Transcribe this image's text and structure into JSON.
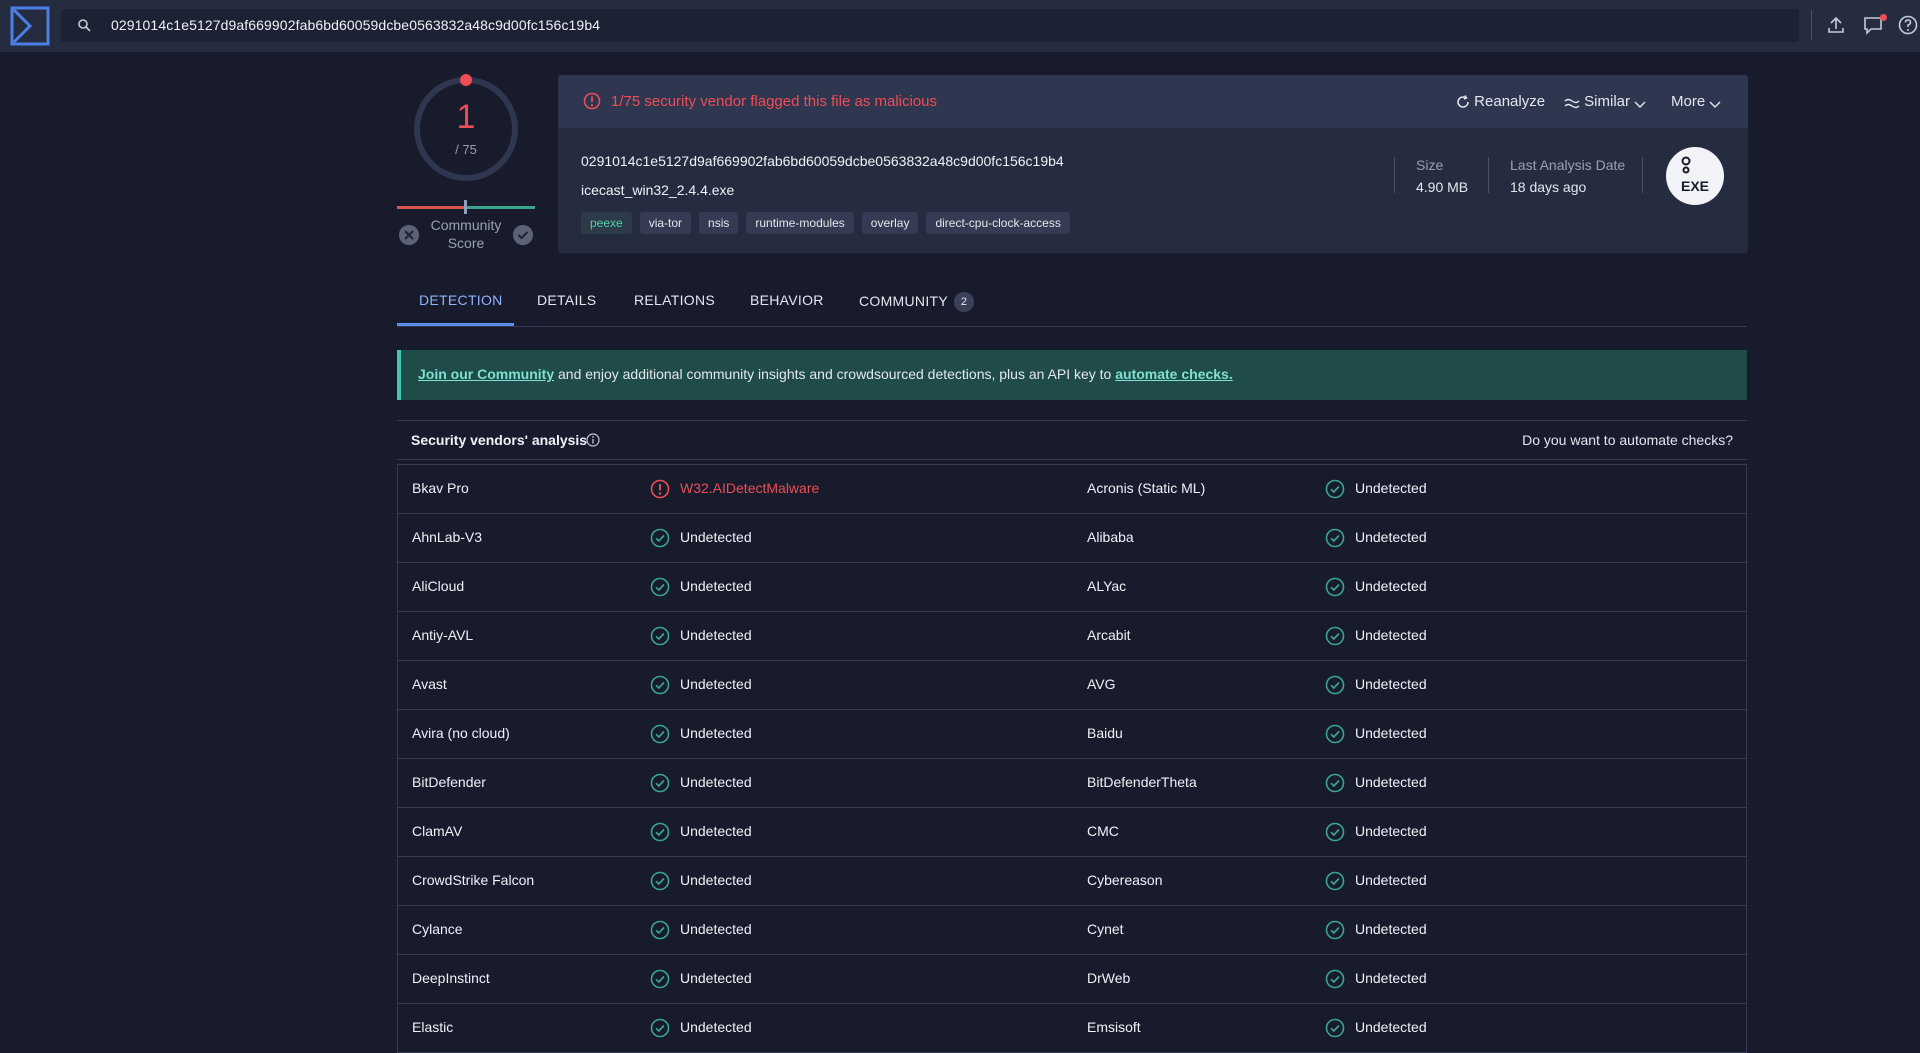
{
  "search": {
    "value": "0291014c1e5127d9af669902fab6bd60059dcbe0563832a48c9d00fc156c19b4"
  },
  "score": {
    "detections": "1",
    "total": "/ 75",
    "community_label_1": "Community",
    "community_label_2": "Score"
  },
  "alert": {
    "text": "1/75 security vendor flagged this file as malicious"
  },
  "actions": {
    "reanalyze": "Reanalyze",
    "similar": "Similar",
    "more": "More"
  },
  "file": {
    "hash": "0291014c1e5127d9af669902fab6bd60059dcbe0563832a48c9d00fc156c19b4",
    "name": "icecast_win32_2.4.4.exe",
    "tags": [
      "peexe",
      "via-tor",
      "nsis",
      "runtime-modules",
      "overlay",
      "direct-cpu-clock-access"
    ],
    "size_label": "Size",
    "size_value": "4.90 MB",
    "date_label": "Last Analysis Date",
    "date_value": "18 days ago",
    "type_badge": "EXE"
  },
  "tabs": [
    {
      "label": "DETECTION"
    },
    {
      "label": "DETAILS"
    },
    {
      "label": "RELATIONS"
    },
    {
      "label": "BEHAVIOR"
    },
    {
      "label": "COMMUNITY",
      "count": "2"
    }
  ],
  "banner": {
    "link1": "Join our Community",
    "middle": " and enjoy additional community insights and crowdsourced detections, plus an API key to ",
    "link2": "automate checks."
  },
  "vendors_section": {
    "title": "Security vendors' analysis",
    "automate": "Do you want to automate checks?"
  },
  "vendors": [
    {
      "left": "Bkav Pro",
      "left_result": "W32.AIDetectMalware",
      "left_malicious": true,
      "right": "Acronis (Static ML)",
      "right_result": "Undetected"
    },
    {
      "left": "AhnLab-V3",
      "left_result": "Undetected",
      "right": "Alibaba",
      "right_result": "Undetected"
    },
    {
      "left": "AliCloud",
      "left_result": "Undetected",
      "right": "ALYac",
      "right_result": "Undetected"
    },
    {
      "left": "Antiy-AVL",
      "left_result": "Undetected",
      "right": "Arcabit",
      "right_result": "Undetected"
    },
    {
      "left": "Avast",
      "left_result": "Undetected",
      "right": "AVG",
      "right_result": "Undetected"
    },
    {
      "left": "Avira (no cloud)",
      "left_result": "Undetected",
      "right": "Baidu",
      "right_result": "Undetected"
    },
    {
      "left": "BitDefender",
      "left_result": "Undetected",
      "right": "BitDefenderTheta",
      "right_result": "Undetected"
    },
    {
      "left": "ClamAV",
      "left_result": "Undetected",
      "right": "CMC",
      "right_result": "Undetected"
    },
    {
      "left": "CrowdStrike Falcon",
      "left_result": "Undetected",
      "right": "Cybereason",
      "right_result": "Undetected"
    },
    {
      "left": "Cylance",
      "left_result": "Undetected",
      "right": "Cynet",
      "right_result": "Undetected"
    },
    {
      "left": "DeepInstinct",
      "left_result": "Undetected",
      "right": "DrWeb",
      "right_result": "Undetected"
    },
    {
      "left": "Elastic",
      "left_result": "Undetected",
      "right": "Emsisoft",
      "right_result": "Undetected"
    }
  ],
  "colors": {
    "malicious": "#ef4d55",
    "clean": "#3aa58d",
    "accent": "#5b8def"
  }
}
